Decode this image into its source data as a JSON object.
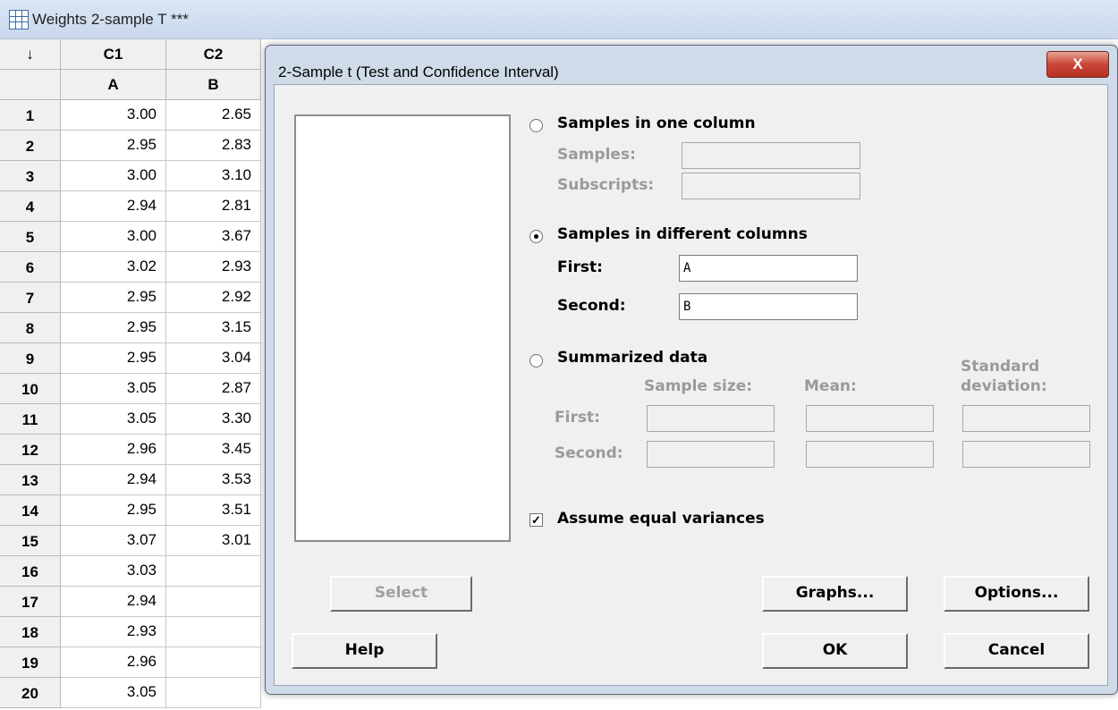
{
  "worksheet": {
    "title": "Weights 2-sample T ***",
    "arrow_header": "↓",
    "columns": [
      {
        "id": "C1",
        "name": "A"
      },
      {
        "id": "C2",
        "name": "B"
      }
    ],
    "rows": [
      {
        "n": "1",
        "a": "3.00",
        "b": "2.65"
      },
      {
        "n": "2",
        "a": "2.95",
        "b": "2.83"
      },
      {
        "n": "3",
        "a": "3.00",
        "b": "3.10"
      },
      {
        "n": "4",
        "a": "2.94",
        "b": "2.81"
      },
      {
        "n": "5",
        "a": "3.00",
        "b": "3.67"
      },
      {
        "n": "6",
        "a": "3.02",
        "b": "2.93"
      },
      {
        "n": "7",
        "a": "2.95",
        "b": "2.92"
      },
      {
        "n": "8",
        "a": "2.95",
        "b": "3.15"
      },
      {
        "n": "9",
        "a": "2.95",
        "b": "3.04"
      },
      {
        "n": "10",
        "a": "3.05",
        "b": "2.87"
      },
      {
        "n": "11",
        "a": "3.05",
        "b": "3.30"
      },
      {
        "n": "12",
        "a": "2.96",
        "b": "3.45"
      },
      {
        "n": "13",
        "a": "2.94",
        "b": "3.53"
      },
      {
        "n": "14",
        "a": "2.95",
        "b": "3.51"
      },
      {
        "n": "15",
        "a": "3.07",
        "b": "3.01"
      },
      {
        "n": "16",
        "a": "3.03",
        "b": ""
      },
      {
        "n": "17",
        "a": "2.94",
        "b": ""
      },
      {
        "n": "18",
        "a": "2.93",
        "b": ""
      },
      {
        "n": "19",
        "a": "2.96",
        "b": ""
      },
      {
        "n": "20",
        "a": "3.05",
        "b": ""
      }
    ]
  },
  "dialog": {
    "title": "2-Sample t (Test and Confidence Interval)",
    "close_glyph": "X",
    "one_column": {
      "label": "Samples in one column",
      "samples_label": "Samples:",
      "subscripts_label": "Subscripts:",
      "selected": false
    },
    "diff_columns": {
      "label": "Samples in different columns",
      "first_label": "First:",
      "first_value": "A",
      "second_label": "Second:",
      "second_value": "B",
      "selected": true
    },
    "summarized": {
      "label": "Summarized data",
      "col_sample_size": "Sample size:",
      "col_mean": "Mean:",
      "col_std_line1": "Standard",
      "col_std_line2": "deviation:",
      "first_label": "First:",
      "second_label": "Second:",
      "selected": false
    },
    "equal_variances": {
      "label": "Assume equal variances",
      "checked": true,
      "check_glyph": "✓"
    },
    "buttons": {
      "select": "Select",
      "graphs": "Graphs...",
      "options": "Options...",
      "help": "Help",
      "ok": "OK",
      "cancel": "Cancel"
    }
  }
}
